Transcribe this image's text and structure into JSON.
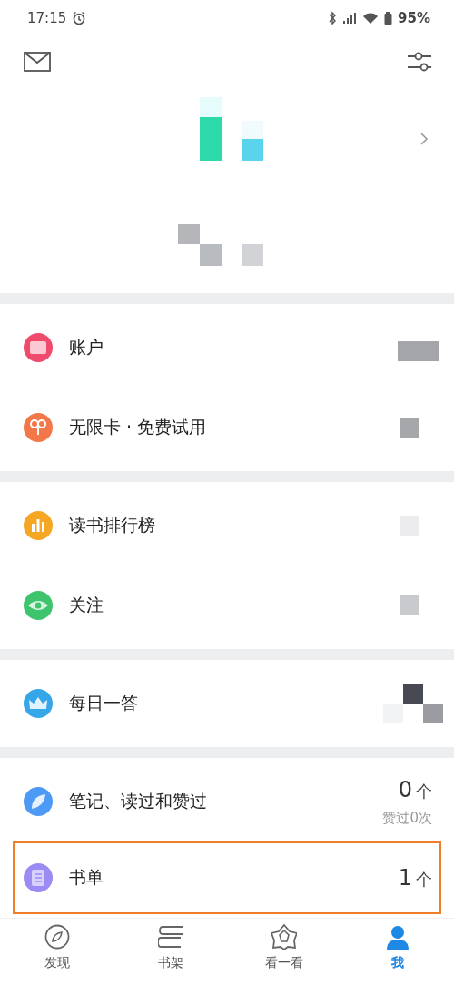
{
  "status_bar": {
    "time": "17:15",
    "battery": "95%"
  },
  "sections": [
    {
      "items": [
        {
          "label": "账户",
          "color": "#f04a6c",
          "highlighted": false
        },
        {
          "label": "无限卡 · 免费试用",
          "color": "#f2784a",
          "highlighted": false
        }
      ]
    },
    {
      "items": [
        {
          "label": "读书排行榜",
          "color": "#f5a623",
          "highlighted": false
        },
        {
          "label": "关注",
          "color": "#3ec46d",
          "highlighted": false
        }
      ]
    },
    {
      "items": [
        {
          "label": "每日一答",
          "color": "#35a6e8",
          "highlighted": false
        }
      ]
    },
    {
      "items": [
        {
          "label": "笔记、读过和赞过",
          "color": "#4c9af5",
          "count": "0",
          "unit": "个",
          "subtext": "赞过0次",
          "highlighted": false
        },
        {
          "label": "书单",
          "color": "#9b8cf5",
          "count": "1",
          "unit": "个",
          "highlighted": true
        }
      ]
    }
  ],
  "tabs": [
    {
      "label": "发现",
      "selected": false
    },
    {
      "label": "书架",
      "selected": false
    },
    {
      "label": "看一看",
      "selected": false
    },
    {
      "label": "我",
      "selected": true
    }
  ]
}
